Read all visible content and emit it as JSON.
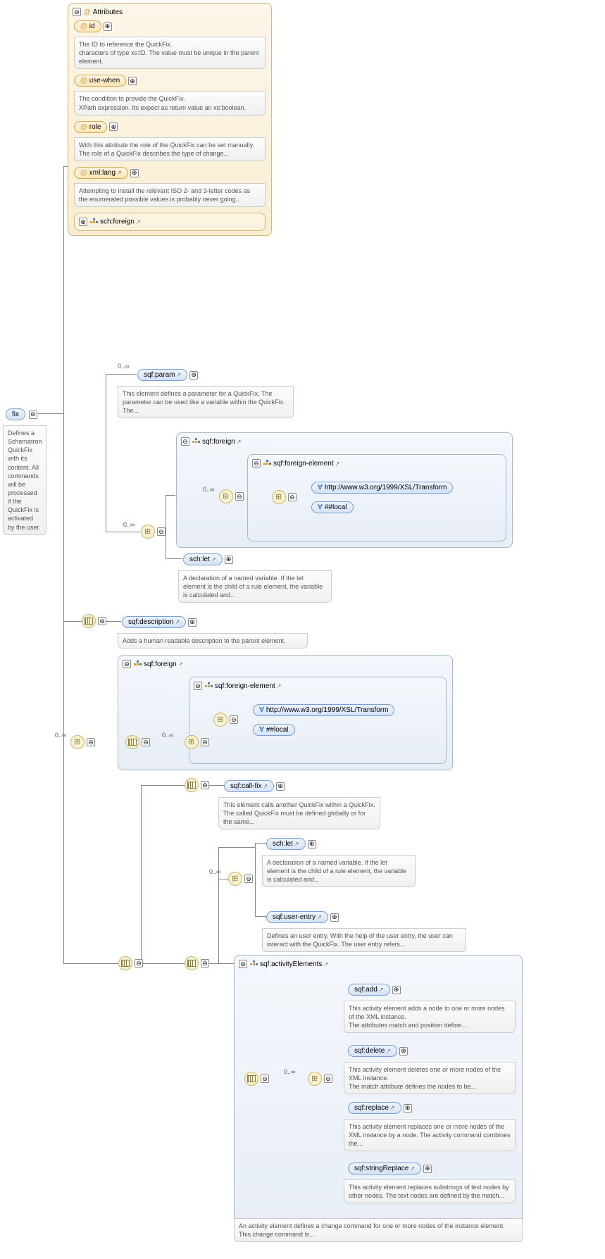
{
  "attrs": {
    "title": "Attributes",
    "id": {
      "label": "id",
      "desc": "The ID to reference the QuickFix.\ncharacters of type xs:ID. The value must be unique in the parent element."
    },
    "usewhen": {
      "label": "use-when",
      "desc": "The condition to provide the QuickFix.\nXPath expression. Its expect as return value an xs:boolean."
    },
    "role": {
      "label": "role",
      "desc": "With this attribute the role of the QuickFix can be set manually.\nThe role of a QuickFix describes the type of change..."
    },
    "xmllang": {
      "label": "xml:lang",
      "desc": "Attempting to install the relevant ISO 2- and 3-letter codes as the enumerated possible values is probably never going..."
    },
    "schforeign": {
      "label": "sch:foreign"
    }
  },
  "fix": {
    "label": "fix",
    "desc": "Defines a Schematron QuickFix with its content. All commands will be processed if the QuickFix is activated by the user."
  },
  "param": {
    "label": "sqf:param",
    "desc": "This element defines a parameter for a QuickFix. The parameter can be used like a variable within the QuickFix. The..."
  },
  "foreign1": {
    "label": "sqf:foreign"
  },
  "foreignEl1": {
    "label": "sqf:foreign-element"
  },
  "xsl": {
    "label": "http://www.w3.org/1999/XSL/Transform"
  },
  "local": {
    "label": "##local"
  },
  "schlet": {
    "label": "sch:let",
    "desc": "A declaration of a named variable. If the let element is the child of a rule element, the variable is calculated and..."
  },
  "description": {
    "label": "sqf:description",
    "desc": "Adds a human readable description to the parent element."
  },
  "foreign2": {
    "label": "sqf:foreign"
  },
  "foreignEl2": {
    "label": "sqf:foreign-element"
  },
  "callfix": {
    "label": "sqf:call-fix",
    "desc": "This element calls another QuickFix within a QuickFix. The called QuickFix must be defined globally or for the same..."
  },
  "schlet2": {
    "label": "sch:let",
    "desc": "A declaration of a named variable. If the let element is the child of a rule element, the variable is calculated and..."
  },
  "userentry": {
    "label": "sqf:user-entry",
    "desc": "Defines an user entry. With the help of the user entry, the user can interact with the QuickFix. The user entry refers..."
  },
  "activityEls": {
    "label": "sqf:activityElements",
    "desc": "An activity element defines a change command for one or more nodes of the instance element. This change command is..."
  },
  "add": {
    "label": "sqf:add",
    "desc": "This activity element adds a node to one or more nodes of the XML instance.\nThe attributes match and position define..."
  },
  "delete": {
    "label": "sqf:delete",
    "desc": "This activity element deletes one or more nodes of the XML instance.\nThe match attribute defines the nodes to be..."
  },
  "replace": {
    "label": "sqf:replace",
    "desc": "This activity element replaces one or more nodes of the XML instance by a node. The activity command combines the..."
  },
  "stringReplace": {
    "label": "sqf:stringReplace",
    "desc": "This activity element replaces substrings of text nodes by other nodes. The text nodes are defined by the match..."
  },
  "occ": "0..∞"
}
